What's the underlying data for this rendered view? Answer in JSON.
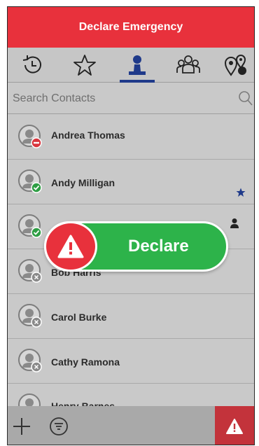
{
  "header": {
    "title": "Declare Emergency"
  },
  "tabs": [
    {
      "icon": "history-icon",
      "selected": false
    },
    {
      "icon": "star-icon",
      "selected": false
    },
    {
      "icon": "person-icon",
      "selected": true
    },
    {
      "icon": "group-icon",
      "selected": false
    },
    {
      "icon": "location-pins-icon",
      "selected": false
    }
  ],
  "search": {
    "placeholder": "Search Contacts"
  },
  "contacts": [
    {
      "name": "Andrea Thomas",
      "status": "busy",
      "status_color": "#d9363e",
      "favorite": false
    },
    {
      "name": "Andy Milligan",
      "status": "available",
      "status_color": "#2e9e44",
      "favorite": true
    },
    {
      "name": "",
      "status": "available",
      "status_color": "#2e9e44",
      "favorite": false,
      "person_badge": true
    },
    {
      "name": "Bob Harris",
      "status": "offline",
      "status_color": "#8a8a8a",
      "favorite": false
    },
    {
      "name": "Carol Burke",
      "status": "offline",
      "status_color": "#8a8a8a",
      "favorite": false
    },
    {
      "name": "Cathy Ramona",
      "status": "offline",
      "status_color": "#8a8a8a",
      "favorite": false
    },
    {
      "name": "Henry Barnes",
      "status": "offline",
      "status_color": "#8a8a8a",
      "favorite": false
    }
  ],
  "declare": {
    "label": "Declare"
  },
  "colors": {
    "accent": "#e8313c",
    "tab_selected": "#1f3a8a",
    "declare_green": "#2db34a"
  }
}
